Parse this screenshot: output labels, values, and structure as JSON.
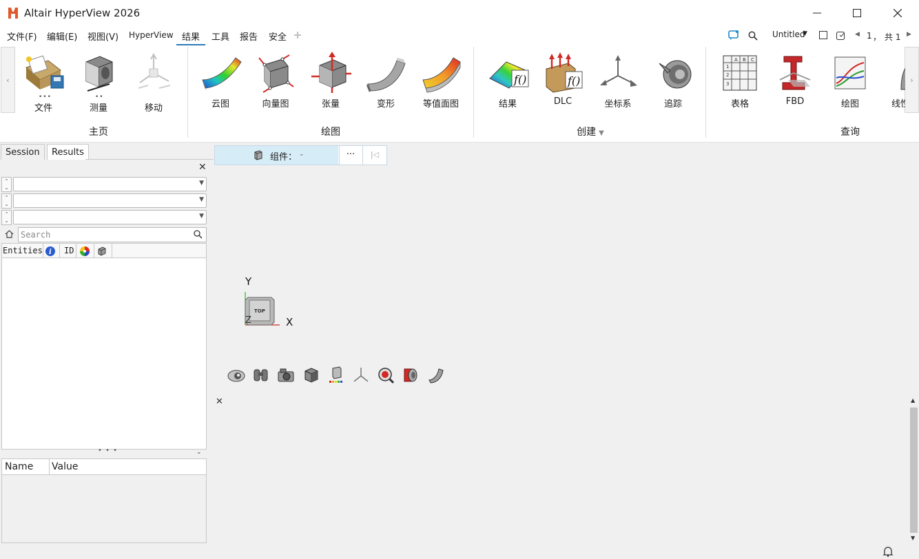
{
  "window": {
    "title": "Altair HyperView 2026",
    "controls": [
      "minimize-icon",
      "maximize-icon",
      "close-icon"
    ]
  },
  "menubar": {
    "items": [
      "文件(F)",
      "编辑(E)",
      "视图(V)",
      "HyperView",
      "结果",
      "工具",
      "报告",
      "安全"
    ],
    "active": "结果",
    "session_name": "Untitled",
    "page_current": "1",
    "page_sep": "，",
    "page_total": "共 1"
  },
  "ribbon": {
    "groups": [
      {
        "label": "主页",
        "tools": [
          "文件",
          "测量",
          "移动"
        ]
      },
      {
        "label": "绘图",
        "tools": [
          "云图",
          "向量图",
          "张量",
          "变形",
          "等值面图"
        ]
      },
      {
        "label": "创建",
        "tools": [
          "结果",
          "DLC",
          "坐标系",
          "追踪"
        ]
      },
      {
        "label": "查询",
        "tools": [
          "表格",
          "FBD",
          "绘图",
          "线性"
        ]
      }
    ],
    "tool_labels": {
      "file": "文件",
      "measure": "测量",
      "move": "移动",
      "contour": "云图",
      "vector": "向量图",
      "tensor": "张量",
      "deform": "变形",
      "isosurface": "等值面图",
      "result": "结果",
      "dlc": "DLC",
      "system": "坐标系",
      "tracking": "追踪",
      "table": "表格",
      "fbd": "FBD",
      "plot": "绘图",
      "linear": "线性"
    },
    "group_labels": {
      "home": "主页",
      "plot": "绘图",
      "create": "创建",
      "query": "查询"
    }
  },
  "left_panel": {
    "tabs": {
      "session": "Session",
      "results": "Results"
    },
    "active_tab": "Results",
    "search_placeholder": "Search",
    "columns": {
      "entities": "Entities",
      "id": "ID"
    },
    "nv_columns": {
      "name": "Name",
      "value": "Value"
    }
  },
  "viewport": {
    "component_label": "组件：",
    "more_label": "···",
    "triad": {
      "y": "Y",
      "x": "X",
      "z": "Z",
      "face": "TOP"
    },
    "tools": [
      "visibility-icon",
      "find-icon",
      "camera-icon",
      "cube-icon",
      "legend-icon",
      "triad-icon",
      "zoom-icon",
      "section-icon",
      "surface-icon"
    ]
  },
  "colors": {
    "accent": "#2a7ab8",
    "component_bg": "#d6ecf7",
    "logo": "#e0592a"
  }
}
